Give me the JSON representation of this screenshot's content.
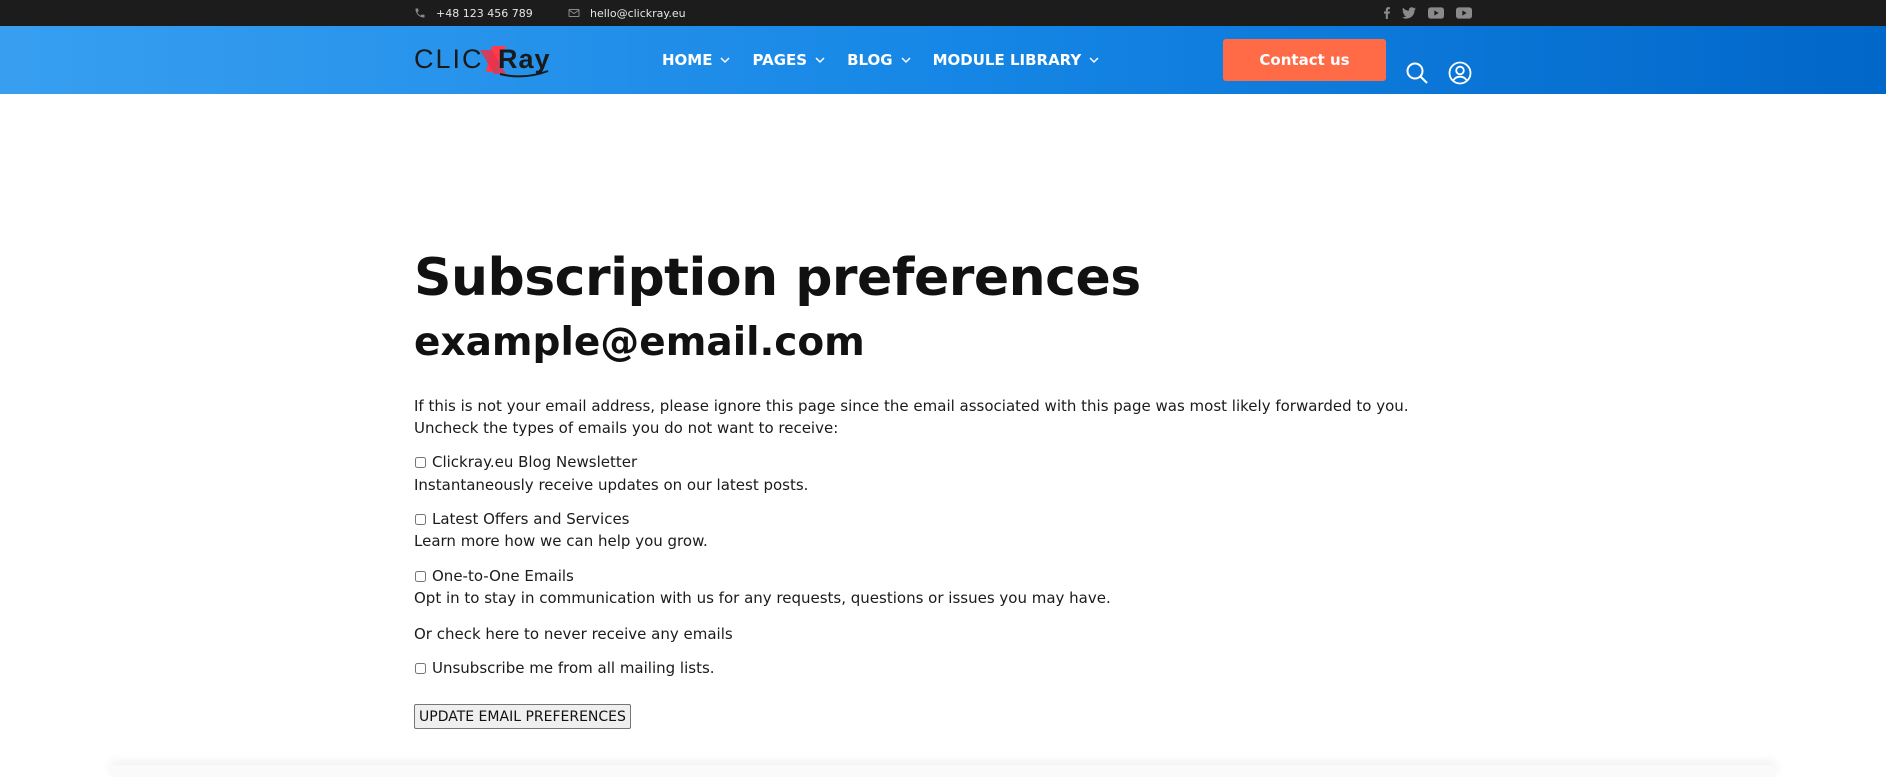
{
  "topbar": {
    "phone": "+48 123 456 789",
    "email": "hello@clickray.eu",
    "social_icons": [
      "facebook-icon",
      "twitter-icon",
      "youtube-icon",
      "youtube-icon"
    ]
  },
  "header": {
    "logo_text": "CLICK Ray",
    "menu": [
      {
        "label": "HOME"
      },
      {
        "label": "PAGES"
      },
      {
        "label": "BLOG"
      },
      {
        "label": "MODULE LIBRARY"
      }
    ],
    "contact_button": "Contact us"
  },
  "page": {
    "title": "Subscription preferences",
    "email": "example@email.com",
    "intro": "If this is not your email address, please ignore this page since the email associated with this page was most likely forwarded to you.",
    "instruction": "Uncheck the types of emails you do not want to receive:",
    "subscriptions": [
      {
        "label": "Clickray.eu Blog Newsletter",
        "description": "Instantaneously receive updates on our latest posts.",
        "checked": false
      },
      {
        "label": "Latest Offers and Services",
        "description": "Learn more how we can help you grow.",
        "checked": false
      },
      {
        "label": "One-to-One Emails",
        "description": "Opt in to stay in communication with us for any requests, questions or issues you may have.",
        "checked": false
      }
    ],
    "or_text": "Or check here to never receive any emails",
    "unsubscribe_label": "Unsubscribe me from all mailing lists.",
    "unsubscribe_checked": false,
    "update_button": "UPDATE EMAIL PREFERENCES"
  },
  "colors": {
    "topbar": "#1c1c1c",
    "nav_start": "#389ff0",
    "nav_end": "#0167c9",
    "cta": "#ff6a47"
  }
}
